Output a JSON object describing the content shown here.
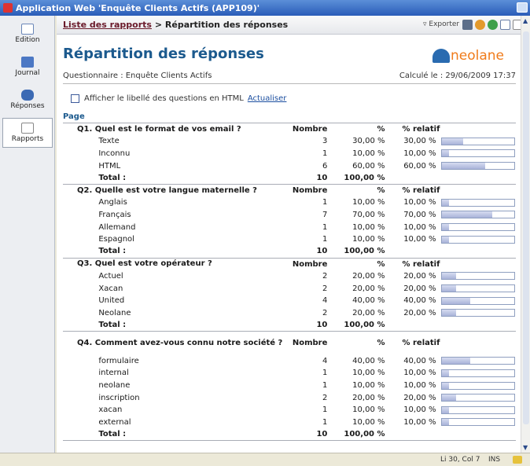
{
  "window": {
    "title": "Application Web 'Enquête Clients Actifs (APP109)'"
  },
  "sidebar": {
    "items": [
      {
        "label": "Edition",
        "icon": "edition-icon"
      },
      {
        "label": "Journal",
        "icon": "journal-icon"
      },
      {
        "label": "Réponses",
        "icon": "responses-icon"
      },
      {
        "label": "Rapports",
        "icon": "reports-icon",
        "active": true
      }
    ]
  },
  "toolbar": {
    "breadcrumb_link": "Liste des rapports",
    "breadcrumb_separator": ">",
    "breadcrumb_current": "Répartition des réponses",
    "export_label": "Exporter"
  },
  "page": {
    "title": "Répartition des réponses",
    "logo": "neolane",
    "questionnaire": "Questionnaire : Enquête Clients Actifs",
    "calculated": "Calculé le : 29/06/2009 17:37",
    "html_option_label": "Afficher le libellé des questions en HTML",
    "refresh_link": "Actualiser",
    "section": "Page"
  },
  "table": {
    "col_count": "Nombre",
    "col_pct": "%",
    "col_rel": "% relatif",
    "total_label": "Total :",
    "questions": [
      {
        "title": "Q1. Quel est le format de vos email ?",
        "total_count": "10",
        "total_pct": "100,00 %",
        "rows": [
          {
            "label": "Texte",
            "count": "3",
            "pct": "30,00 %",
            "rel": "30,00 %",
            "fill": 0.3
          },
          {
            "label": "Inconnu",
            "count": "1",
            "pct": "10,00 %",
            "rel": "10,00 %",
            "fill": 0.1
          },
          {
            "label": "HTML",
            "count": "6",
            "pct": "60,00 %",
            "rel": "60,00 %",
            "fill": 0.6
          }
        ]
      },
      {
        "title": "Q2. Quelle est votre langue maternelle ?",
        "total_count": "10",
        "total_pct": "100,00 %",
        "rows": [
          {
            "label": "Anglais",
            "count": "1",
            "pct": "10,00 %",
            "rel": "10,00 %",
            "fill": 0.1
          },
          {
            "label": "Français",
            "count": "7",
            "pct": "70,00 %",
            "rel": "70,00 %",
            "fill": 0.7
          },
          {
            "label": "Allemand",
            "count": "1",
            "pct": "10,00 %",
            "rel": "10,00 %",
            "fill": 0.1
          },
          {
            "label": "Espagnol",
            "count": "1",
            "pct": "10,00 %",
            "rel": "10,00 %",
            "fill": 0.1
          }
        ]
      },
      {
        "title": "Q3. Quel est votre opérateur ?",
        "total_count": "10",
        "total_pct": "100,00 %",
        "rows": [
          {
            "label": "Actuel",
            "count": "2",
            "pct": "20,00 %",
            "rel": "20,00 %",
            "fill": 0.2
          },
          {
            "label": "Xacan",
            "count": "2",
            "pct": "20,00 %",
            "rel": "20,00 %",
            "fill": 0.2
          },
          {
            "label": "United",
            "count": "4",
            "pct": "40,00 %",
            "rel": "40,00 %",
            "fill": 0.4
          },
          {
            "label": "Neolane",
            "count": "2",
            "pct": "20,00 %",
            "rel": "20,00 %",
            "fill": 0.2
          }
        ]
      },
      {
        "title": "Q4. Comment avez-vous connu notre société ?",
        "total_count": "10",
        "total_pct": "100,00 %",
        "rows": [
          {
            "label": "formulaire",
            "count": "4",
            "pct": "40,00 %",
            "rel": "40,00 %",
            "fill": 0.4
          },
          {
            "label": "internal",
            "count": "1",
            "pct": "10,00 %",
            "rel": "10,00 %",
            "fill": 0.1
          },
          {
            "label": "neolane",
            "count": "1",
            "pct": "10,00 %",
            "rel": "10,00 %",
            "fill": 0.1
          },
          {
            "label": "inscription",
            "count": "2",
            "pct": "20,00 %",
            "rel": "20,00 %",
            "fill": 0.2
          },
          {
            "label": "xacan",
            "count": "1",
            "pct": "10,00 %",
            "rel": "10,00 %",
            "fill": 0.1
          },
          {
            "label": "external",
            "count": "1",
            "pct": "10,00 %",
            "rel": "10,00 %",
            "fill": 0.1
          }
        ]
      }
    ]
  },
  "status": {
    "position": "Li 30, Col 7",
    "mode": "INS"
  }
}
